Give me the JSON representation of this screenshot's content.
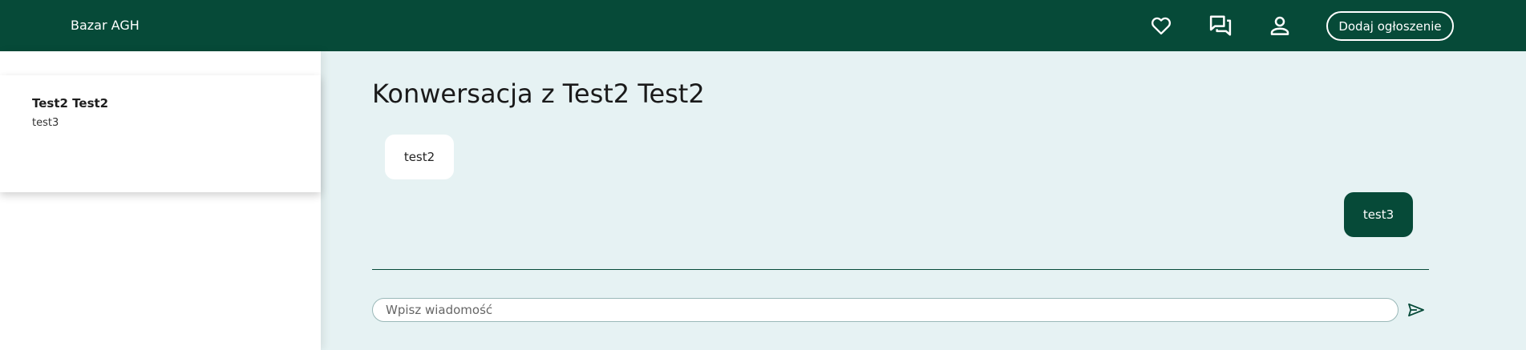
{
  "header": {
    "brand": "Bazar AGH",
    "icons": [
      "heart-icon",
      "chat-icon",
      "user-icon"
    ],
    "add_listing_label": "Dodaj ogłoszenie"
  },
  "sidebar": {
    "conversations": [
      {
        "name": "Test2 Test2",
        "preview": "test3"
      }
    ]
  },
  "main": {
    "title": "Konwersacja z Test2 Test2",
    "messages": [
      {
        "text": "test2",
        "direction": "incoming"
      },
      {
        "text": "test3",
        "direction": "outgoing"
      }
    ],
    "input": {
      "placeholder": "Wpisz wiadomość",
      "value": ""
    },
    "send_icon": "send-icon"
  },
  "colors": {
    "primary": "#064a38",
    "background": "#e6f2f3",
    "surface": "#ffffff"
  }
}
